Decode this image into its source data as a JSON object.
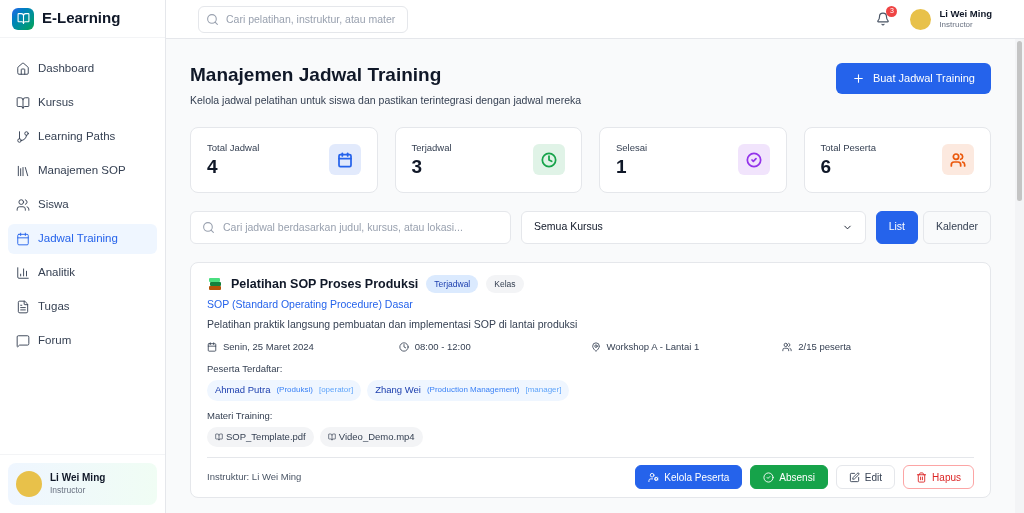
{
  "brand": {
    "name": "E-Learning"
  },
  "sidebar": {
    "items": [
      {
        "label": "Dashboard",
        "selected": false
      },
      {
        "label": "Kursus",
        "selected": false
      },
      {
        "label": "Learning Paths",
        "selected": false
      },
      {
        "label": "Manajemen SOP",
        "selected": false
      },
      {
        "label": "Siswa",
        "selected": false
      },
      {
        "label": "Jadwal Training",
        "selected": true
      },
      {
        "label": "Analitik",
        "selected": false
      },
      {
        "label": "Tugas",
        "selected": false
      },
      {
        "label": "Forum",
        "selected": false
      }
    ],
    "user": {
      "name": "Li Wei Ming",
      "role": "Instructor"
    }
  },
  "header": {
    "search": {
      "placeholder": "Cari pelatihan, instruktur, atau mater"
    },
    "notifications": "3",
    "user": {
      "name": "Li Wei Ming",
      "role": "Instructor"
    }
  },
  "page": {
    "title": "Manajemen Jadwal Training",
    "subtitle": "Kelola jadwal pelatihan untuk siswa dan pastikan terintegrasi dengan jadwal mereka",
    "create_button": "Buat Jadwal Training"
  },
  "stats": [
    {
      "label": "Total Jadwal",
      "value": "4",
      "color": "#2563eb"
    },
    {
      "label": "Terjadwal",
      "value": "3",
      "color": "#16a34a"
    },
    {
      "label": "Selesai",
      "value": "1",
      "color": "#9333ea"
    },
    {
      "label": "Total Peserta",
      "value": "6",
      "color": "#ea580c"
    }
  ],
  "filters": {
    "search": {
      "placeholder": "Cari jadwal berdasarkan judul, kursus, atau lokasi..."
    },
    "course_select": "Semua Kursus",
    "views": [
      {
        "label": "List",
        "selected": true
      },
      {
        "label": "Kalender",
        "selected": false
      }
    ]
  },
  "schedules": [
    {
      "title": "Pelatihan SOP Proses Produksi",
      "status": "Terjadwal",
      "type": "Kelas",
      "course": "SOP (Standard Operating Procedure) Dasar",
      "description": "Pelatihan praktik langsung pembuatan dan implementasi SOP di lantai produksi",
      "date": "Senin, 25 Maret 2024",
      "time": "08:00 - 12:00",
      "location": "Workshop A - Lantai 1",
      "participants_count": "2/15 peserta",
      "participants_label": "Peserta Terdaftar:",
      "participants": [
        {
          "name": "Ahmad Putra",
          "department": "(Produksi)",
          "role": "[operator]"
        },
        {
          "name": "Zhang Wei",
          "department": "(Production Management)",
          "role": "[manager]"
        }
      ],
      "materials_label": "Materi Training:",
      "materials": [
        "SOP_Template.pdf",
        "Video_Demo.mp4"
      ],
      "instructor": "Instruktur: Li Wei Ming",
      "actions": [
        {
          "label": "Kelola Peserta",
          "kind": "primary"
        },
        {
          "label": "Absensi",
          "kind": "success"
        },
        {
          "label": "Edit",
          "kind": "outline"
        },
        {
          "label": "Hapus",
          "kind": "danger"
        }
      ]
    }
  ]
}
